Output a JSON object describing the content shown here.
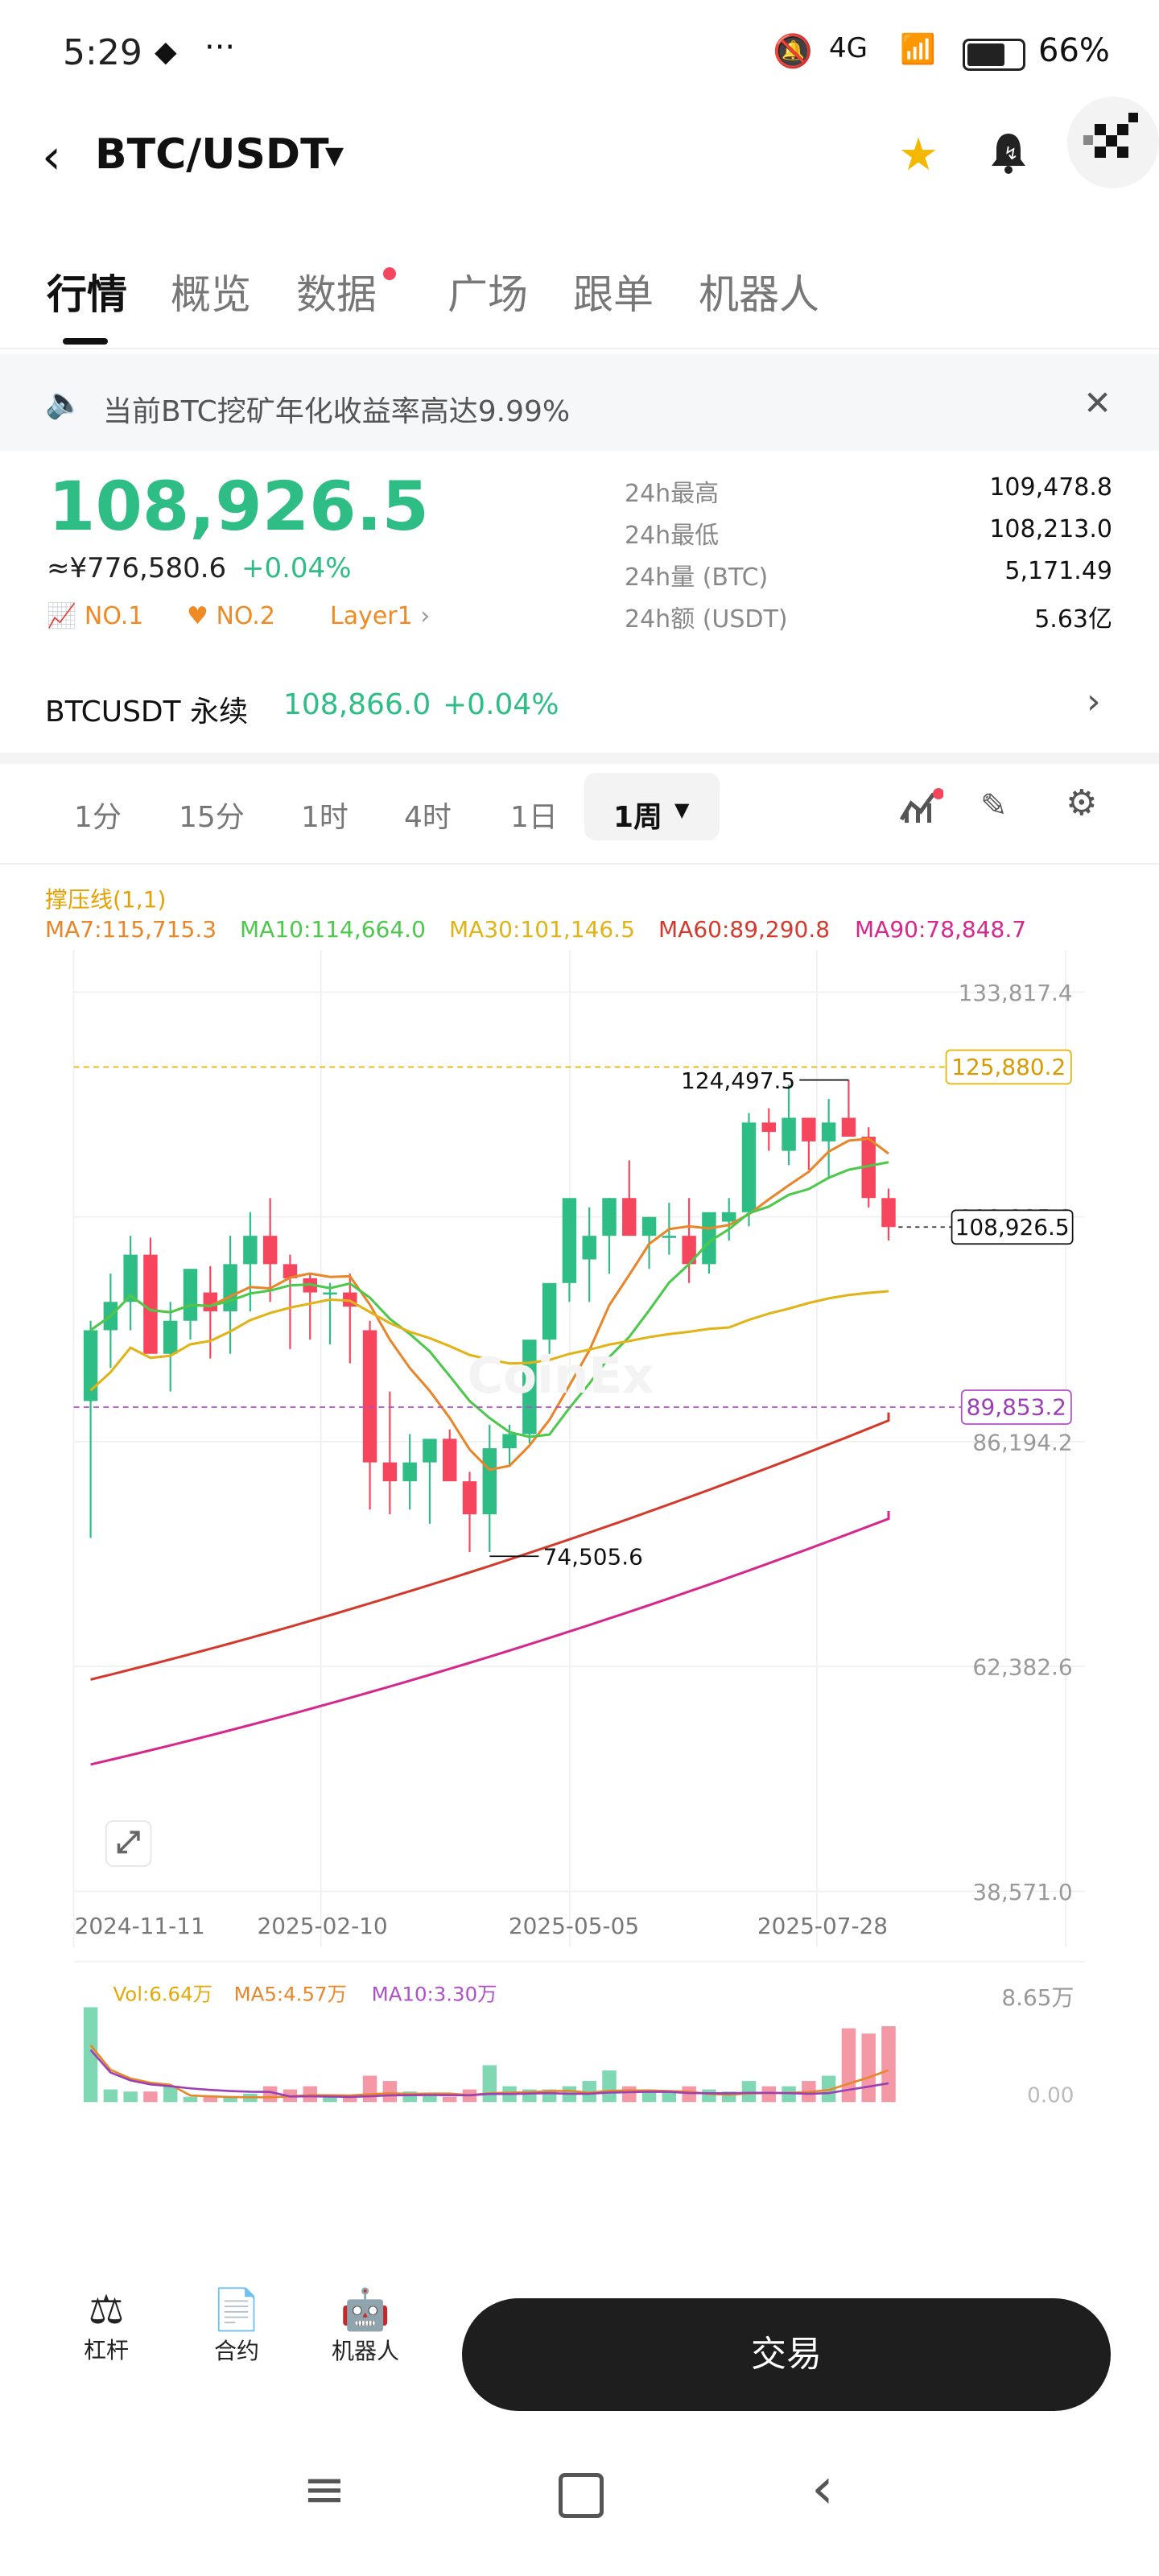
{
  "status_bar": {
    "time": "5:29",
    "battery": "66%",
    "network": "4G"
  },
  "header": {
    "pair": "BTC/USDT"
  },
  "tabs": [
    {
      "label": "行情",
      "active": true
    },
    {
      "label": "概览"
    },
    {
      "label": "数据",
      "dot": true
    },
    {
      "label": "广场"
    },
    {
      "label": "跟单"
    },
    {
      "label": "机器人"
    }
  ],
  "notice": {
    "text": "当前BTC挖矿年化收益率高达9.99%"
  },
  "ticker": {
    "last_price": "108,926.5",
    "cny_approx": "≈¥776,580.6",
    "change": "+0.04%",
    "tags": [
      "NO.1",
      "NO.2",
      "Layer1"
    ],
    "stats": [
      {
        "label": "24h最高",
        "value": "109,478.8"
      },
      {
        "label": "24h最低",
        "value": "108,213.0"
      },
      {
        "label": "24h量 (BTC)",
        "value": "5,171.49"
      },
      {
        "label": "24h额 (USDT)",
        "value": "5.63亿"
      }
    ]
  },
  "perpetual": {
    "label": "BTCUSDT 永续",
    "price": "108,866.0",
    "change": "+0.04%"
  },
  "intervals": [
    "1分",
    "15分",
    "1时",
    "4时",
    "1日",
    "1周"
  ],
  "selected_interval": "1周",
  "indicators": {
    "resistance": "撑压线(1,1)",
    "ma7": "MA7:115,715.3",
    "ma10": "MA10:114,664.0",
    "ma30": "MA30:101,146.5",
    "ma60": "MA60:89,290.8",
    "ma90": "MA90:78,848.7"
  },
  "chart_data": {
    "type": "candlestick",
    "y_ticks": [
      "133,817.4",
      "110,005.0",
      "86,194.2",
      "62,382.6",
      "38,571.0"
    ],
    "ylim": [
      38571.0,
      133817.4
    ],
    "x_ticks": [
      "2024-11-11",
      "2025-02-10",
      "2025-05-05",
      "2025-07-28"
    ],
    "annotations": {
      "high_label": "124,497.5",
      "low_label": "74,505.6",
      "current_price": "108,926.5",
      "resistance_line": "125,880.2",
      "support_line": "89,853.2"
    },
    "candles": [
      [
        90500,
        99000,
        76000,
        98000
      ],
      [
        98000,
        104000,
        94000,
        101000
      ],
      [
        101000,
        108000,
        98000,
        106000
      ],
      [
        106000,
        107800,
        96000,
        95500
      ],
      [
        95500,
        101000,
        91500,
        99000
      ],
      [
        99000,
        104000,
        97000,
        104500
      ],
      [
        102000,
        104800,
        95000,
        100000
      ],
      [
        100000,
        108000,
        95500,
        105000
      ],
      [
        105000,
        110500,
        100000,
        108000
      ],
      [
        108000,
        112000,
        101000,
        105000
      ],
      [
        105000,
        106000,
        96000,
        103500
      ],
      [
        103500,
        104000,
        97000,
        102000
      ],
      [
        102000,
        103000,
        96500,
        102000
      ],
      [
        102000,
        104000,
        94500,
        100500
      ],
      [
        98000,
        99000,
        79000,
        84000
      ],
      [
        84000,
        91500,
        78500,
        82000
      ],
      [
        82000,
        87000,
        79000,
        84000
      ],
      [
        84000,
        85000,
        77500,
        86500
      ],
      [
        86500,
        87500,
        82000,
        82000
      ],
      [
        82000,
        83000,
        74500,
        78500
      ],
      [
        78500,
        88000,
        74505,
        85500
      ],
      [
        85500,
        88000,
        83500,
        87000
      ],
      [
        87000,
        96000,
        86000,
        97000
      ],
      [
        97000,
        100000,
        95500,
        103000
      ],
      [
        103000,
        110500,
        101000,
        112000
      ],
      [
        105500,
        111000,
        101000,
        108000
      ],
      [
        108000,
        112000,
        104000,
        112000
      ],
      [
        112000,
        116000,
        108000,
        108000
      ],
      [
        108000,
        110000,
        104500,
        110000
      ],
      [
        108000,
        111500,
        106000,
        108000
      ],
      [
        108000,
        112000,
        103000,
        105000
      ],
      [
        105000,
        110500,
        104000,
        110500
      ],
      [
        109500,
        112000,
        107500,
        110500
      ],
      [
        110500,
        121000,
        109000,
        120000
      ],
      [
        120000,
        121500,
        117000,
        119000
      ],
      [
        117000,
        124000,
        115500,
        120500
      ],
      [
        120500,
        120500,
        115000,
        118000
      ],
      [
        118000,
        122500,
        114000,
        120000
      ],
      [
        120500,
        124497.5,
        119000,
        118500
      ],
      [
        118500,
        119500,
        111000,
        112000
      ],
      [
        112000,
        113000,
        107500,
        108926.5
      ]
    ],
    "ma_series": {
      "ma7": "orange",
      "ma10": "green",
      "ma30": "gold",
      "ma60": "red",
      "ma90": "magenta"
    }
  },
  "volume": {
    "vol": "Vol:6.64万",
    "ma5": "MA5:4.57万",
    "ma10": "MA10:3.30万",
    "top_tick": "8.65万",
    "bottom_tick": "0.00"
  },
  "bottom_bar": {
    "items": [
      "杠杆",
      "合约",
      "机器人"
    ],
    "trade": "交易"
  },
  "colors": {
    "up": "#2ebd85",
    "down": "#f6465d",
    "accent": "#111111"
  }
}
